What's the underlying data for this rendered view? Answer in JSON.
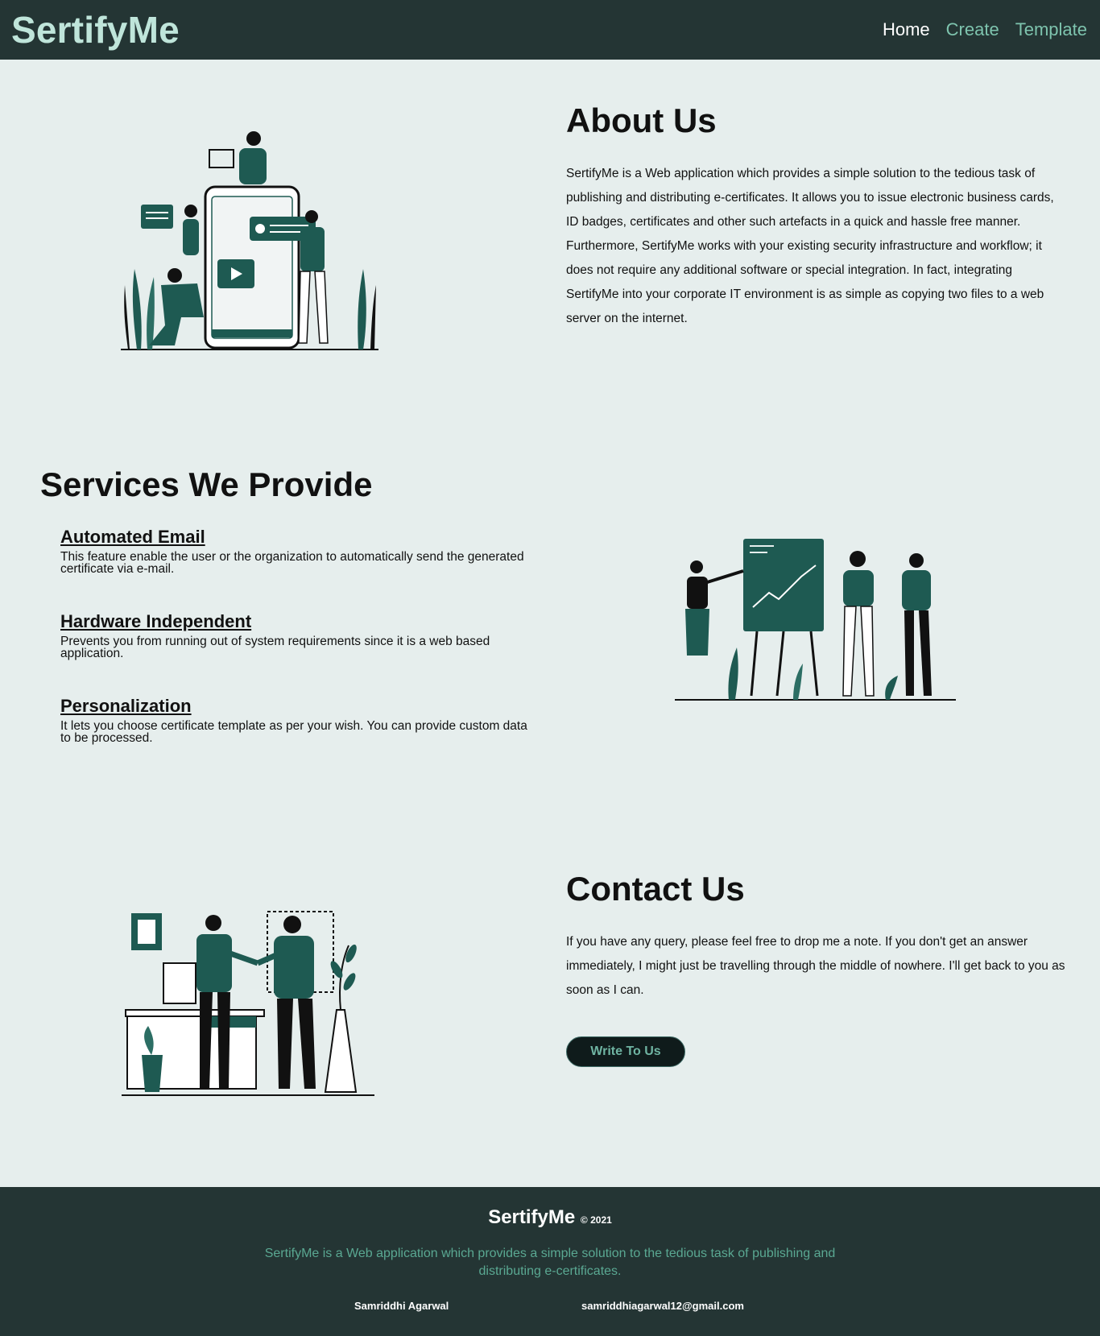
{
  "nav": {
    "brand": "SertifyMe",
    "links": [
      "Home",
      "Create",
      "Template"
    ]
  },
  "about": {
    "title": "About Us",
    "text": "SertifyMe is a Web application which provides a simple solution to the tedious task of publishing and distributing e-certificates. It allows you to issue electronic business cards, ID badges, certificates and other such artefacts in a quick and hassle free manner. Furthermore, SertifyMe works with your existing security infrastructure and workflow; it does not require any additional software or special integration. In fact, integrating SertifyMe into your corporate IT environment is as simple as copying two files to a web server on the internet."
  },
  "services": {
    "title": "Services We Provide",
    "items": [
      {
        "title": "Automated Email",
        "desc": "This feature enable the user or the organization to automatically send the generated certificate via e-mail."
      },
      {
        "title": "Hardware Independent",
        "desc": "Prevents you from running out of system requirements since it is a web based application."
      },
      {
        "title": "Personalization",
        "desc": "It lets you choose certificate template as per your wish. You can provide custom data to be processed."
      }
    ]
  },
  "contact": {
    "title": "Contact Us",
    "text": "If you have any query, please feel free to drop me a note. If you don't get an answer immediately, I might just be travelling through the middle of nowhere. I'll get back to you as soon as I can.",
    "button": "Write To Us"
  },
  "footer": {
    "brand": "SertifyMe",
    "copyright": "© 2021",
    "desc": "SertifyMe is a Web application which provides a simple solution to the tedious task of publishing and distributing e-certificates.",
    "name": "Samriddhi Agarwal",
    "email": "samriddhiagarwal12@gmail.com"
  },
  "colors": {
    "navbar_bg": "#243534",
    "page_bg": "#e6eeed",
    "brand": "#bfe5da",
    "accent": "#1e5a52",
    "link": "#7ec4ae"
  }
}
